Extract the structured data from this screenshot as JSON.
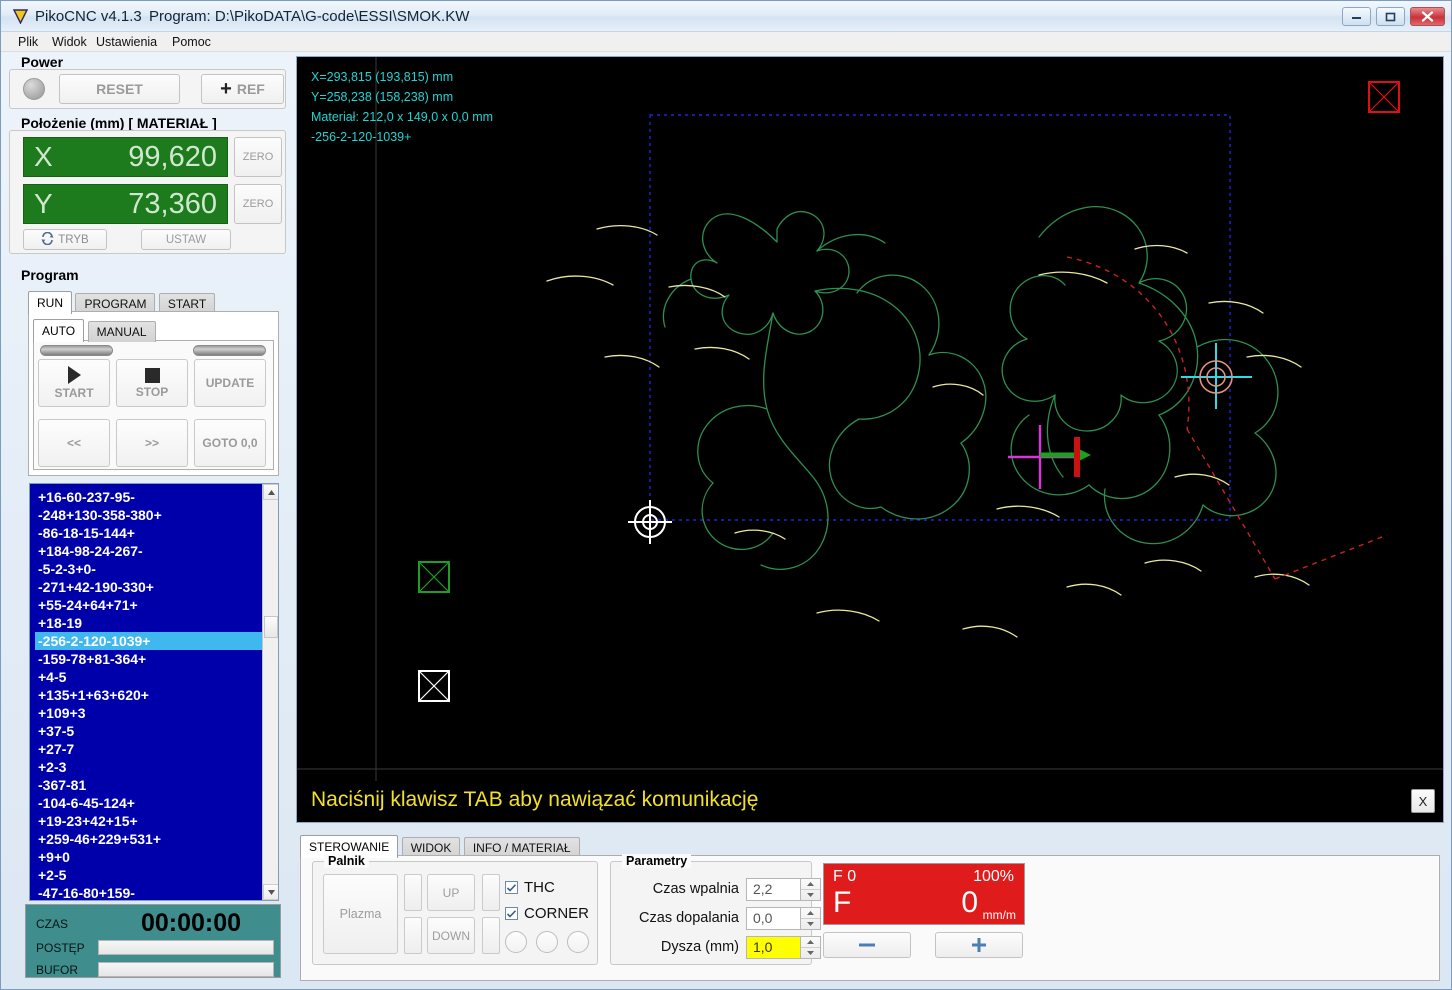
{
  "window": {
    "title": "PikoCNC v4.1.3",
    "program_label": "Program: D:\\PikoDATA\\G-code\\ESSI\\SMOK.KW",
    "minimize": "minimize-icon",
    "maximize": "maximize-icon",
    "close": "close-icon"
  },
  "menu": [
    {
      "label": "Plik"
    },
    {
      "label": "Widok"
    },
    {
      "label": "Ustawienia"
    },
    {
      "label": "Pomoc"
    }
  ],
  "power": {
    "title": "Power",
    "reset_label": "RESET",
    "ref_label": "REF",
    "ref_plus": "+"
  },
  "position": {
    "title": "Położenie (mm) [ MATERIAŁ ]",
    "axes": [
      {
        "name": "X",
        "value": "99,620",
        "zero_label": "ZERO"
      },
      {
        "name": "Y",
        "value": "73,360",
        "zero_label": "ZERO"
      }
    ],
    "tryb_label": "TRYB",
    "ustaw_label": "USTAW"
  },
  "program": {
    "title": "Program",
    "tabs": [
      {
        "label": "RUN",
        "active": true
      },
      {
        "label": "PROGRAM",
        "active": false
      },
      {
        "label": "START",
        "active": false
      }
    ],
    "subtabs": [
      {
        "label": "AUTO",
        "active": true
      },
      {
        "label": "MANUAL",
        "active": false
      }
    ],
    "buttons": {
      "start": "START",
      "stop": "STOP",
      "update": "UPDATE",
      "prev": "<<",
      "next": ">>",
      "goto": "GOTO 0,0"
    }
  },
  "gcode": {
    "selected_index": 8,
    "lines": [
      "+16-60-237-95-",
      "-248+130-358-380+",
      "-86-18-15-144+",
      "+184-98-24-267-",
      "-5-2-3+0-",
      "-271+42-190-330+",
      "+55-24+64+71+",
      "+18-19",
      "-256-2-120-1039+",
      "-159-78+81-364+",
      "+4-5",
      "+135+1+63+620+",
      "+109+3",
      "+37-5",
      "+27-7",
      "+2-3",
      "-367-81",
      "-104-6-45-124+",
      "+19-23+42+15+",
      "+259-46+229+531+",
      "+9+0",
      "+2-5",
      "-47-16-80+159-"
    ]
  },
  "status": {
    "czas_label": "CZAS",
    "czas_value": "00:00:00",
    "postep_label": "POSTĘP",
    "postep_percent": 0,
    "bufor_label": "BUFOR",
    "bufor_percent": 0
  },
  "viewport": {
    "overlay": [
      "X=293,815 (193,815) mm",
      "Y=258,238 (158,238) mm",
      "Materiał: 212,0 x 149,0 x 0,0 mm",
      "-256-2-120-1039+"
    ],
    "colors": {
      "background": "#000000",
      "overlay_text": "#22d3d3",
      "toolpath": "#2f8f4f",
      "rapid": "#cc2222",
      "highlight": "#e8e8a0",
      "boundary": "#2222dd",
      "marker_green": "#1f9f1f",
      "marker_white": "#ffffff",
      "marker_red": "#dd1111",
      "crosshair_cyan": "#30d8e8",
      "crosshair_magenta": "#dd33dd"
    }
  },
  "message": {
    "text": "Naciśnij klawisz TAB aby nawiązać komunikację",
    "close_label": "X",
    "color": "#f2e12a"
  },
  "bottom": {
    "tabs": [
      {
        "label": "STEROWANIE",
        "active": true
      },
      {
        "label": "WIDOK",
        "active": false
      },
      {
        "label": "INFO / MATERIAŁ",
        "active": false
      }
    ],
    "palnik": {
      "title": "Palnik",
      "plazma_label": "Plazma",
      "up_label": "UP",
      "down_label": "DOWN",
      "thc_label": "THC",
      "thc_checked": true,
      "corner_label": "CORNER",
      "corner_checked": true
    },
    "parametry": {
      "title": "Parametry",
      "rows": [
        {
          "label": "Czas wpalnia",
          "value": "2,2",
          "highlight": false
        },
        {
          "label": "Czas dopalania",
          "value": "0,0",
          "highlight": false
        },
        {
          "label": "Dysza (mm)",
          "value": "1,0",
          "highlight": true
        }
      ]
    },
    "feed": {
      "override_label": "F 0",
      "override_percent": "100%",
      "f_label": "F",
      "f_value": "0",
      "unit": "mm/m",
      "minus_label": "−",
      "plus_label": "+",
      "color": "#e01b1b"
    }
  }
}
